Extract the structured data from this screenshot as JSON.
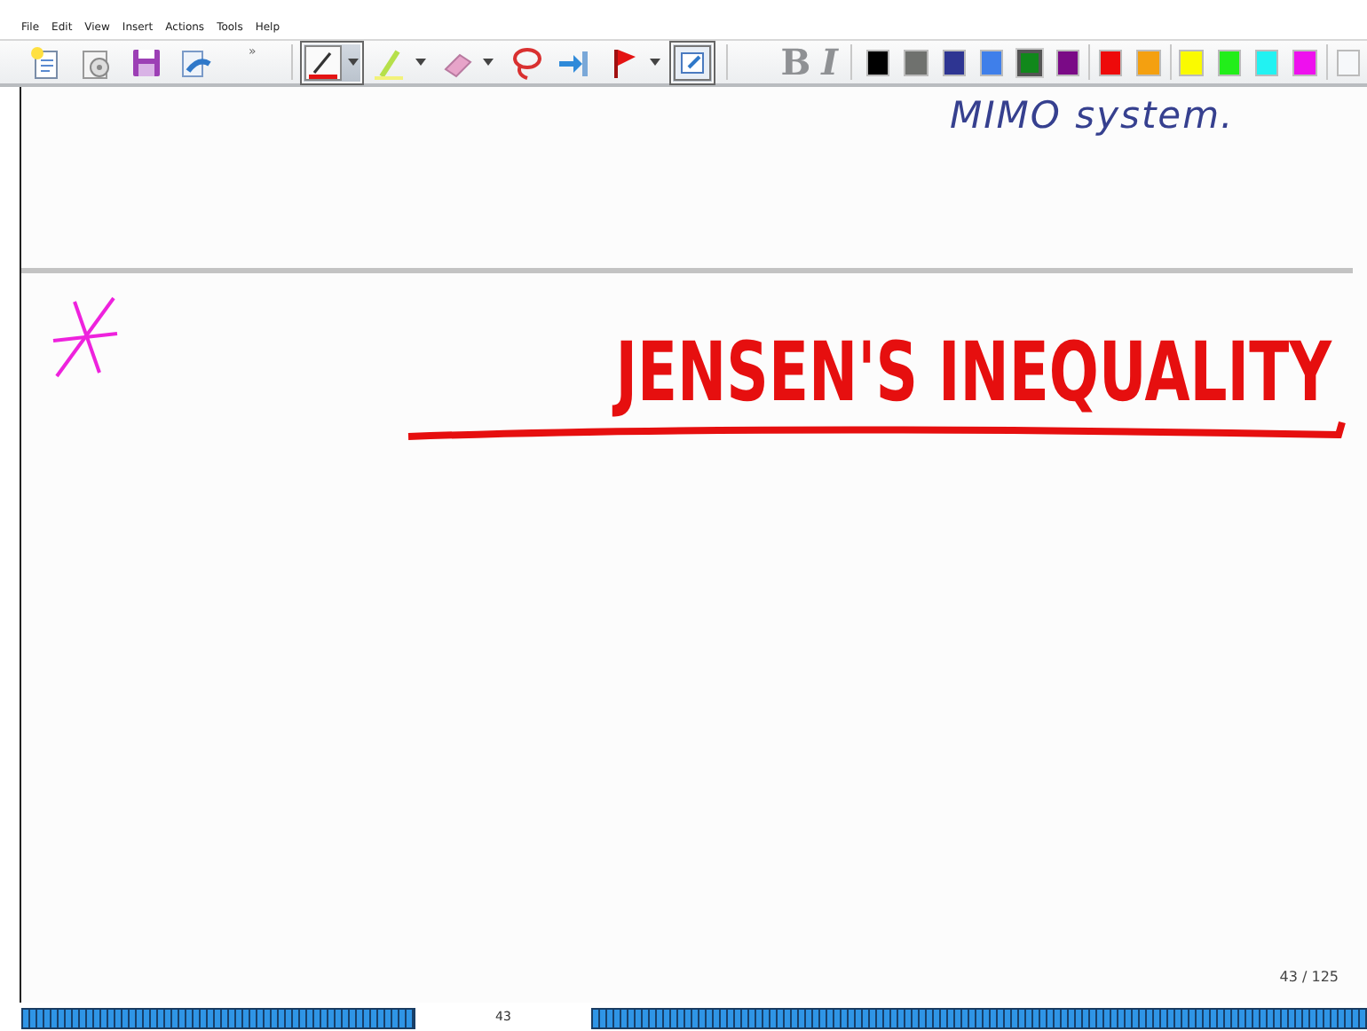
{
  "menu": [
    "File",
    "Edit",
    "View",
    "Insert",
    "Actions",
    "Tools",
    "Help"
  ],
  "toolbar": {
    "tools": [
      {
        "kind": "new-note",
        "selected": false,
        "dropdown": false
      },
      {
        "kind": "disc",
        "selected": false,
        "dropdown": false
      },
      {
        "kind": "save",
        "selected": false,
        "dropdown": false
      },
      {
        "kind": "send",
        "selected": false,
        "dropdown": false
      },
      {
        "kind": "overflow",
        "label": "»"
      },
      {
        "kind": "pen",
        "selected": true,
        "dropdown": true
      },
      {
        "kind": "highlighter",
        "selected": false,
        "dropdown": true
      },
      {
        "kind": "eraser",
        "selected": false,
        "dropdown": true
      },
      {
        "kind": "lasso",
        "selected": false,
        "dropdown": false
      },
      {
        "kind": "insert-space",
        "selected": false,
        "dropdown": false
      },
      {
        "kind": "flag",
        "selected": false,
        "dropdown": true
      },
      {
        "kind": "select-box",
        "selected": true,
        "dropdown": false
      }
    ],
    "format": [
      {
        "label": "B",
        "disabled": true
      },
      {
        "label": "I",
        "disabled": true
      }
    ],
    "swatches": [
      {
        "color": "#000000",
        "selected": false
      },
      {
        "color": "#6f716e",
        "selected": false
      },
      {
        "color": "#2e3592",
        "selected": false
      },
      {
        "color": "#3f7fea",
        "selected": false
      },
      {
        "color": "#11881b",
        "selected": true
      },
      {
        "color": "#7a0a86",
        "selected": false
      },
      {
        "color": "#ee0a0a",
        "selected": false
      },
      {
        "color": "#f4a010",
        "selected": false
      },
      {
        "color": "#fafa00",
        "selected": false
      },
      {
        "color": "#22ee1a",
        "selected": false
      },
      {
        "color": "#22f2f2",
        "selected": false
      },
      {
        "color": "#ee10ee",
        "selected": false
      },
      {
        "color": "#f6f8fa",
        "selected": false
      }
    ]
  },
  "page": {
    "side_note": "MIMO system.",
    "heading": "JENSEN'S INEQUALITY",
    "page_counter": "43 / 125"
  },
  "footer": {
    "page_number": "43"
  }
}
